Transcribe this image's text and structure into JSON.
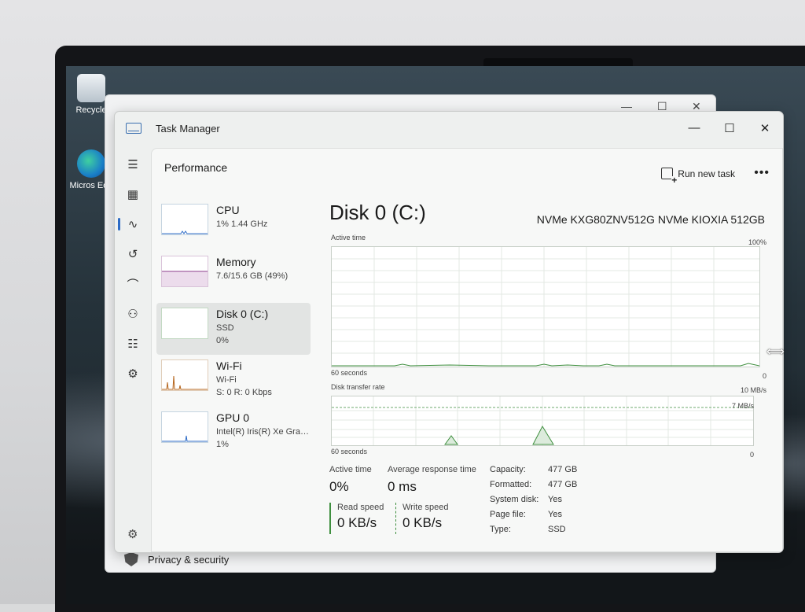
{
  "desktop": {
    "icons": [
      {
        "label": "Recycle",
        "icon": "recycle-bin-icon"
      },
      {
        "label": "Micros Edg",
        "icon": "edge-icon"
      }
    ]
  },
  "settings_window": {
    "privacy_label": "Privacy & security"
  },
  "window": {
    "title": "Task Manager",
    "minimize": "—",
    "maximize": "☐",
    "close": "✕"
  },
  "nav": [
    {
      "name": "menu",
      "glyph": "☰"
    },
    {
      "name": "processes",
      "glyph": "▦"
    },
    {
      "name": "performance",
      "glyph": "∿"
    },
    {
      "name": "app-history",
      "glyph": "↺"
    },
    {
      "name": "startup-apps",
      "glyph": "⌒"
    },
    {
      "name": "users",
      "glyph": "⚇"
    },
    {
      "name": "details",
      "glyph": "☷"
    },
    {
      "name": "services",
      "glyph": "⚙"
    }
  ],
  "settings_glyph": "⚙",
  "header": {
    "page_title": "Performance",
    "run_new_task": "Run new task",
    "more": "•••"
  },
  "resources": [
    {
      "title": "CPU",
      "line1": "1%  1.44 GHz",
      "line2": ""
    },
    {
      "title": "Memory",
      "line1": "7.6/15.6 GB (49%)",
      "line2": ""
    },
    {
      "title": "Disk 0 (C:)",
      "line1": "SSD",
      "line2": "0%"
    },
    {
      "title": "Wi-Fi",
      "line1": "Wi-Fi",
      "line2": "S: 0  R: 0 Kbps"
    },
    {
      "title": "GPU 0",
      "line1": "Intel(R) Iris(R) Xe Grap...",
      "line2": "1%"
    }
  ],
  "detail": {
    "title": "Disk 0 (C:)",
    "model": "NVMe KXG80ZNV512G NVMe KIOXIA 512GB",
    "graph1": {
      "label": "Active time",
      "max": "100%",
      "xlabel": "60 seconds",
      "min": "0"
    },
    "graph2": {
      "label": "Disk transfer rate",
      "max": "10 MB/s",
      "mid": "7 MB/s",
      "xlabel": "60 seconds",
      "min": "0"
    },
    "stats": {
      "active_time_label": "Active time",
      "active_time_value": "0%",
      "avg_response_label": "Average response time",
      "avg_response_value": "0 ms",
      "read_label": "Read speed",
      "read_value": "0 KB/s",
      "write_label": "Write speed",
      "write_value": "0 KB/s"
    },
    "properties": [
      {
        "k": "Capacity:",
        "v": "477 GB"
      },
      {
        "k": "Formatted:",
        "v": "477 GB"
      },
      {
        "k": "System disk:",
        "v": "Yes"
      },
      {
        "k": "Page file:",
        "v": "Yes"
      },
      {
        "k": "Type:",
        "v": "SSD"
      }
    ]
  },
  "colors": {
    "accent": "#2d6bc6",
    "disk_graph": "#3f8f3f",
    "memory_graph": "#8e3f8e",
    "cpu_graph": "#2d6bc6",
    "wifi_graph": "#b5651d"
  }
}
